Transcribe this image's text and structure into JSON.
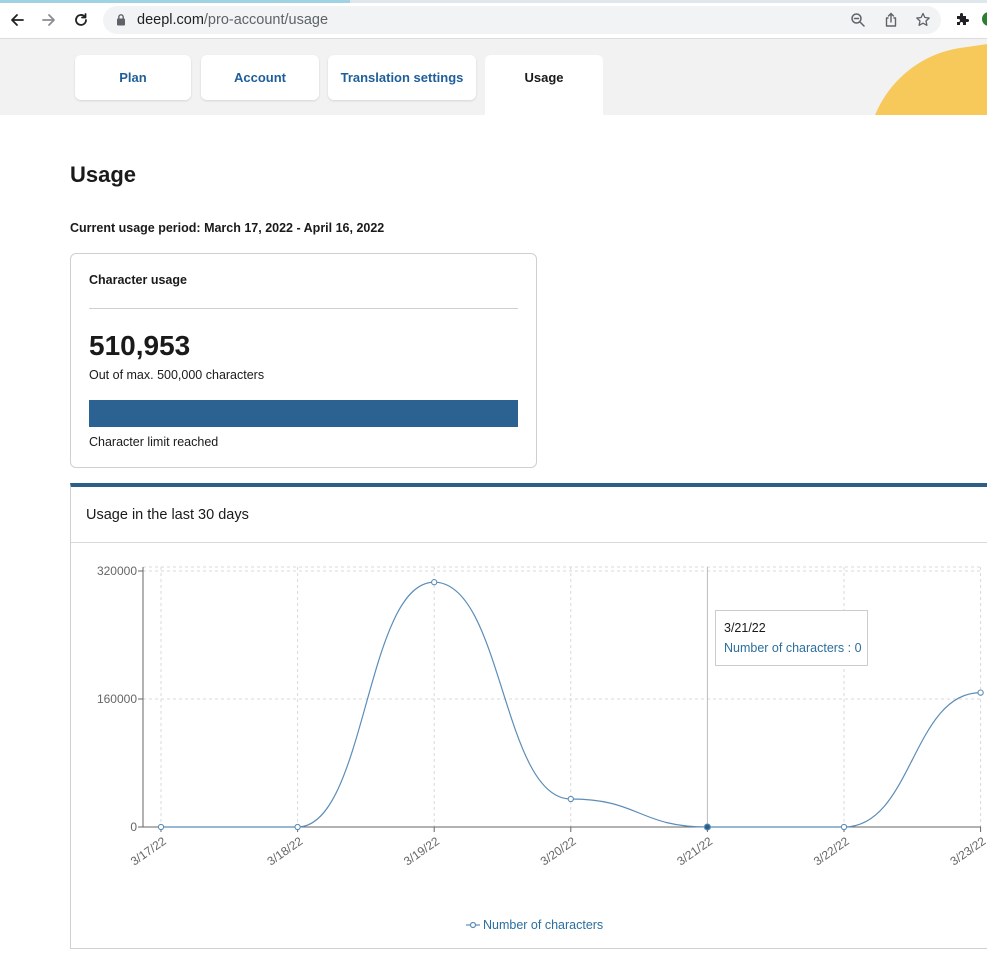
{
  "browser": {
    "url_domain": "deepl.com",
    "url_path": "/pro-account/usage"
  },
  "tabs": [
    {
      "label": "Plan",
      "active": false
    },
    {
      "label": "Account",
      "active": false
    },
    {
      "label": "Translation settings",
      "active": false
    },
    {
      "label": "Usage",
      "active": true
    }
  ],
  "page": {
    "title": "Usage",
    "period_label": "Current usage period:",
    "period_value": "March 17, 2022 - April 16, 2022"
  },
  "character_usage": {
    "title": "Character usage",
    "count": "510,953",
    "max_text": "Out of max. 500,000 characters",
    "fill_fraction": 1.0,
    "status": "Character limit reached",
    "bar_color": "#2b6291"
  },
  "usage_chart": {
    "title": "Usage in the last 30 days",
    "tooltip": {
      "date": "3/21/22",
      "text": "Number of characters : 0"
    },
    "legend": "Number of characters"
  },
  "chart_data": {
    "type": "line",
    "categories": [
      "3/17/22",
      "3/18/22",
      "3/19/22",
      "3/20/22",
      "3/21/22",
      "3/22/22",
      "3/23/22"
    ],
    "series": [
      {
        "name": "Number of characters",
        "values": [
          0,
          0,
          306000,
          35000,
          0,
          0,
          168000
        ]
      }
    ],
    "yticks": [
      "0",
      "160000",
      "320000"
    ],
    "ylim": [
      0,
      320000
    ],
    "grid": true,
    "legend_position": "bottom",
    "line_color": "#5b8db8"
  }
}
